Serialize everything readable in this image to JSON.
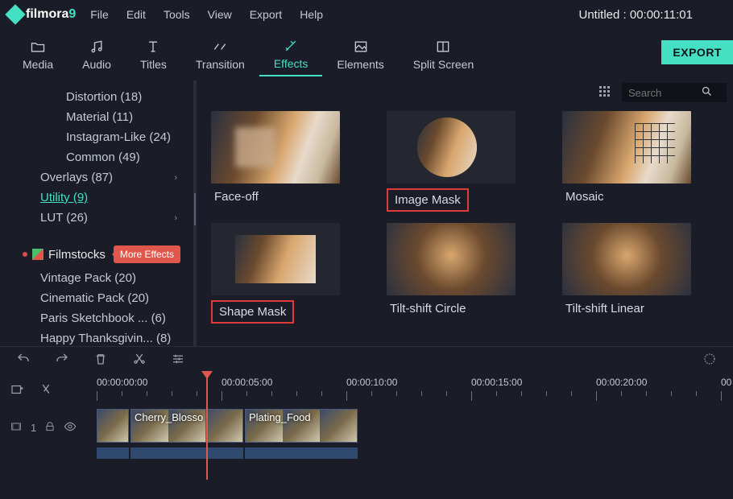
{
  "app": {
    "name": "filmora",
    "version": "9"
  },
  "menu": [
    "File",
    "Edit",
    "Tools",
    "View",
    "Export",
    "Help"
  ],
  "project_title": "Untitled : 00:00:11:01",
  "tabs": [
    {
      "id": "media",
      "label": "Media"
    },
    {
      "id": "audio",
      "label": "Audio"
    },
    {
      "id": "titles",
      "label": "Titles"
    },
    {
      "id": "transition",
      "label": "Transition"
    },
    {
      "id": "effects",
      "label": "Effects",
      "active": true
    },
    {
      "id": "elements",
      "label": "Elements"
    },
    {
      "id": "split-screen",
      "label": "Split Screen"
    }
  ],
  "export_label": "EXPORT",
  "sidebar": {
    "items": [
      {
        "label": "Distortion (18)",
        "type": "child"
      },
      {
        "label": "Material (11)",
        "type": "child"
      },
      {
        "label": "Instagram-Like (24)",
        "type": "child"
      },
      {
        "label": "Common (49)",
        "type": "child"
      },
      {
        "label": "Overlays (87)",
        "type": "parent"
      },
      {
        "label": "Utility (9)",
        "type": "parent",
        "active": true
      },
      {
        "label": "LUT (26)",
        "type": "parent"
      }
    ],
    "filmstocks": {
      "label": "Filmstocks",
      "badge": "More Effects"
    },
    "fs_items": [
      "Vintage Pack (20)",
      "Cinematic Pack (20)",
      "Paris Sketchbook ... (6)",
      "Happy Thanksgivin... (8)"
    ]
  },
  "search": {
    "placeholder": "Search"
  },
  "thumbs": [
    {
      "label": "Face-off",
      "hl": false,
      "style": "face"
    },
    {
      "label": "Image Mask",
      "hl": true,
      "style": "imask"
    },
    {
      "label": "Mosaic",
      "hl": false,
      "style": "mosaic"
    },
    {
      "label": "Shape Mask",
      "hl": true,
      "style": "shape"
    },
    {
      "label": "Tilt-shift Circle",
      "hl": false,
      "style": "dark"
    },
    {
      "label": "Tilt-shift Linear",
      "hl": false,
      "style": "dark"
    }
  ],
  "timecodes": [
    "00:00:00:00",
    "00:00:05:00",
    "00:00:10:00",
    "00:00:15:00",
    "00:00:20:00",
    "00"
  ],
  "track": {
    "num": "1"
  },
  "clips": [
    {
      "label": "",
      "cls": "clip2"
    },
    {
      "label": "Cherry_Blosso",
      "cls": "clip3"
    },
    {
      "label": "Plating_Food",
      "cls": "clip4"
    }
  ]
}
